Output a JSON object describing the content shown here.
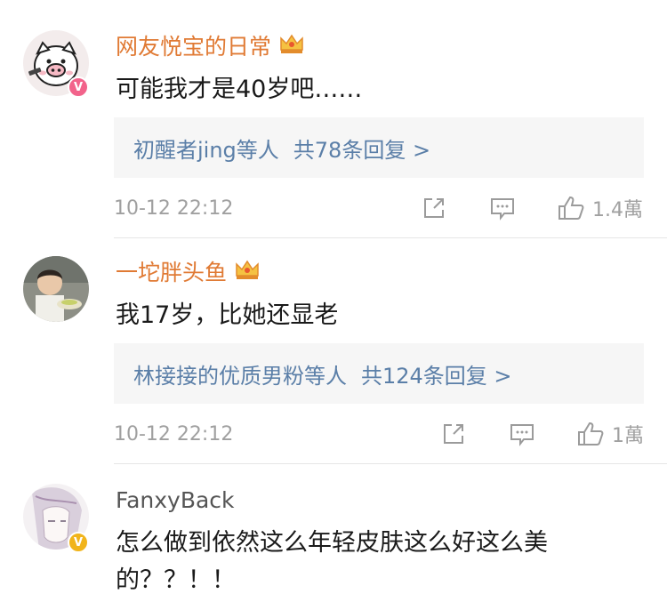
{
  "comments": [
    {
      "username": "网友悦宝的日常",
      "text": "可能我才是40岁吧……",
      "replies_names": "初醒者jing等人",
      "replies_count": "共78条回复 >",
      "time": "10-12 22:12",
      "likes": "1.4萬",
      "badge": "V"
    },
    {
      "username": "一坨胖头鱼",
      "text": "我17岁，比她还显老",
      "replies_names": "林接接的优质男粉等人",
      "replies_count": "共124条回复 >",
      "time": "10-12 22:12",
      "likes": "1萬"
    },
    {
      "username": "FanxyBack",
      "text_line1": "怎么做到依然这么年轻皮肤这么好这么美",
      "text_line2": "的？？！！",
      "badge": "V"
    }
  ],
  "colors": {
    "vip_name": "#e07a34",
    "reply_link": "#5b7fa8",
    "meta": "#a0a0a0",
    "reply_bg": "#f6f6f6",
    "badge_pink": "#f2638b",
    "badge_gold": "#f1b41b"
  },
  "icons": [
    "pig-avatar-icon",
    "crown-icon",
    "share-icon",
    "comment-icon",
    "thumbs-up-icon"
  ]
}
